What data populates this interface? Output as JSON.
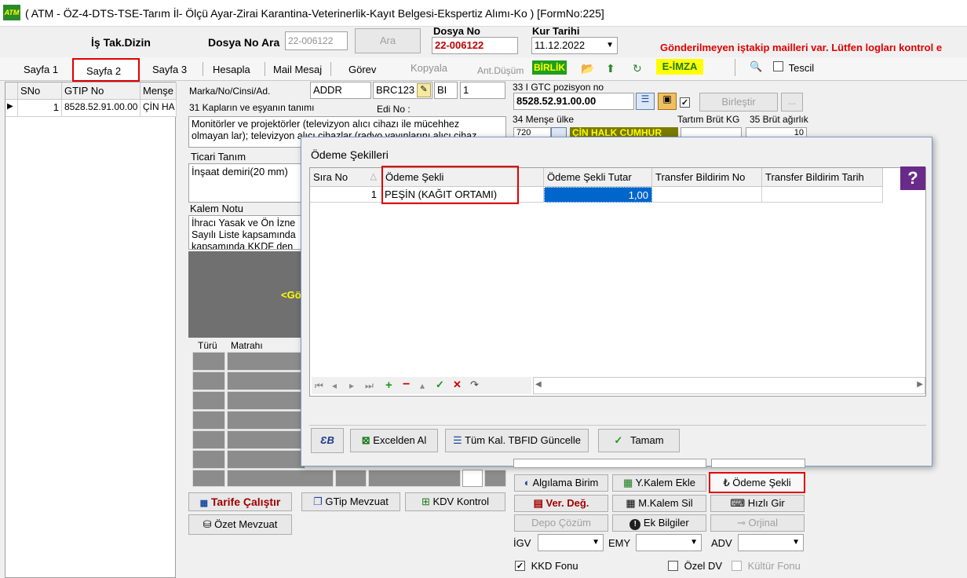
{
  "window": {
    "title": "( ATM - ÖZ-4-DTS-TSE-Tarım İl- Ölçü Ayar-Zirai Karantina-Veterinerlik-Kayıt Belgesi-Ekspertiz Alımı-Ko ) [FormNo:225]",
    "logo_text": "ATM"
  },
  "header": {
    "is_tak_dizin": "İş Tak.Dizin",
    "dosya_no_ara_label": "Dosya No Ara",
    "dosya_no_ara_placeholder": "22-006122",
    "ara_button": "Ara",
    "dosya_no_label": "Dosya No",
    "dosya_no_value": "22-006122",
    "kur_tarihi_label": "Kur Tarihi",
    "kur_tarihi_value": "11.12.2022",
    "warning": "Gönderilmeyen iştakip mailleri var. Lütfen logları kontrol e"
  },
  "tabs": [
    "Sayfa 1",
    "Sayfa 2",
    "Sayfa 3",
    "Hesapla",
    "Mail Mesaj",
    "Görev",
    "Kopyala",
    "Ant.Düşüm"
  ],
  "toolbar": {
    "birlik": "BİRLİK",
    "eimza": "E-İMZA",
    "tescil": "Tescil"
  },
  "left_grid": {
    "headers": [
      "SNo",
      "GTIP No",
      "Menşe"
    ],
    "rows": [
      {
        "sno": "1",
        "gtip": "8528.52.91.00.00",
        "mense": "ÇİN HA"
      }
    ]
  },
  "form": {
    "marka_label": "Marka/No/Cinsi/Ad.",
    "marka_value": "ADDR",
    "brc_value": "BRC123",
    "bi_value": "BI",
    "bi_num": "1",
    "kaplar_label": "31 Kapların ve eşyanın tanımı",
    "edi_label": "Edi No :",
    "kaplar_text1": "Monitörler ve projektörler (televizyon alıcı cihazı ile mücehhez",
    "kaplar_text2": "olmayan lar); televizyon alıcı cihazlar (radyo yayınlarını alıcı cihaz",
    "ticari_label": "Ticari Tanım",
    "ticari_text": "İnşaat demiri(20 mm)",
    "kalem_notu_label": "Kalem Notu",
    "kalem_notu_l1": "İhracı Yasak ve Ön İzne",
    "kalem_notu_l2": "Sayılı Liste kapsamında",
    "kalem_notu_l3": "kapsamında KKDF den",
    "dark_text": "<Gö",
    "turu_label": "Türü",
    "matrahi_label": "Matrahı",
    "gtip_pos_label": "33 I GTC pozisyon no",
    "gtip_pos_value": "8528.52.91.00.00",
    "birlestir": "Birleştir",
    "mense_label": "34 Menşe ülke",
    "tartim_label": "Tartım Brüt KG",
    "brut_label": "35 Brüt ağırlık",
    "mense_code": "720",
    "mense_name": "ÇİN HALK CUMHUR",
    "brut_value": "10"
  },
  "modal": {
    "title": "Ödeme Şekilleri",
    "columns": [
      "Sıra No",
      "Ödeme Şekli",
      "Ödeme Şekli Tutar",
      "Transfer Bildirim No",
      "Transfer Bildirim Tarih"
    ],
    "rows": [
      {
        "sira": "1",
        "sekil": "PEŞİN (KAĞIT ORTAMI)",
        "tutar": "1,00",
        "bno": "",
        "btarih": ""
      }
    ],
    "excelden_al": "Excelden Al",
    "tum_kal": "Tüm Kal. TBFID Güncelle",
    "tamam": "Tamam"
  },
  "bottom_buttons": {
    "algilama": "Algılama Birim",
    "y_kalem": "Y.Kalem Ekle",
    "odeme_sekli": "Ödeme Şekli",
    "ver_deg": "Ver. Değ.",
    "m_kalem": "M.Kalem Sil",
    "hizli_gir": "Hızlı Gir",
    "depo": "Depo Çözüm",
    "ek_bilgiler": "Ek Bilgiler",
    "orjinal": "Orjinal",
    "tarife": "Tarife Çalıştır",
    "gtip_mevzuat": "GTip Mevzuat",
    "kdv_kontrol": "KDV Kontrol",
    "ozet": "Özet Mevzuat",
    "igv": "İGV",
    "emy": "EMY",
    "adv": "ADV",
    "kkd": "KKD Fonu",
    "ozel_dv": "Özel DV",
    "kultur": "Kültür Fonu"
  },
  "colors": {
    "accent_red": "#e00000",
    "birlik_bg": "#1f9e1f",
    "eimza_bg": "#ffff00",
    "selected_cell": "#0066cc"
  }
}
